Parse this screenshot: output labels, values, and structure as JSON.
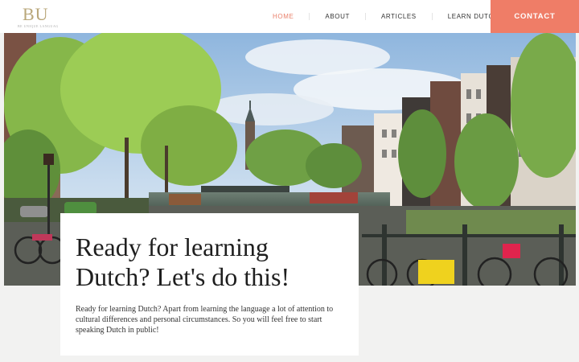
{
  "brand": {
    "logo_letters": "BU",
    "tagline": "BE UNIQUE LANGUAGE"
  },
  "nav": {
    "items": [
      {
        "label": "HOME",
        "active": true
      },
      {
        "label": "ABOUT",
        "active": false
      },
      {
        "label": "ARTICLES",
        "active": false
      },
      {
        "label": "LEARN DUTCH",
        "active": false
      }
    ],
    "contact_label": "CONTACT"
  },
  "hero": {
    "heading": "Ready for learning Dutch? Let's do this!",
    "body": "Ready for learning Dutch? Apart from learning the language a lot of attention to cultural differences and personal circumstances. So you will feel free to start speaking Dutch in public!"
  },
  "colors": {
    "accent": "#ef7d67",
    "nav_active": "#e9806b",
    "page_bg": "#f2f2f1",
    "card_bg": "#ffffff"
  }
}
